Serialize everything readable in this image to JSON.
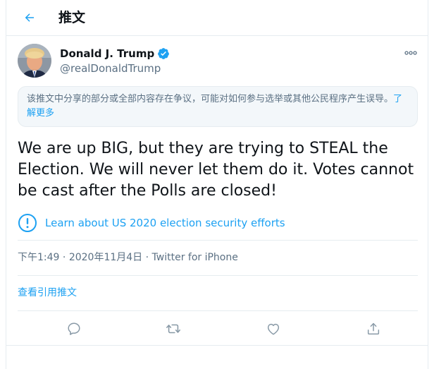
{
  "header": {
    "back_icon": "arrow-left-icon",
    "title": "推文"
  },
  "author": {
    "name": "Donald J. Trump",
    "handle": "@realDonaldTrump",
    "verified_icon": "verified-badge-icon",
    "more_icon": "more-options-icon"
  },
  "notice": {
    "text": "该推文中分享的部分或全部内容存在争议，可能对如何参与选举或其他公民程序产生误导。",
    "link": "了解更多"
  },
  "tweet": {
    "line1": "We are up BIG, but they are trying to STEAL the",
    "line2": "Election. We will never let them do it. Votes cannot",
    "line3": "be cast after the Polls are closed!"
  },
  "election_notice": {
    "icon": "exclamation-circle-icon",
    "label": "Learn about US 2020 election security efforts"
  },
  "meta": {
    "time": "下午1:49",
    "sep1": " · ",
    "date": "2020年11月4日",
    "sep2": " · ",
    "source": "Twitter for iPhone"
  },
  "quotes_link": "查看引用推文",
  "actions": [
    {
      "icon": "reply-icon"
    },
    {
      "icon": "retweet-icon"
    },
    {
      "icon": "like-icon"
    },
    {
      "icon": "share-icon"
    }
  ],
  "colors": {
    "accent": "#1da1f2",
    "text": "#0f1419",
    "secondary": "#5b7083",
    "border": "#e6ecf0",
    "notice_bg": "#f3f7fa"
  }
}
